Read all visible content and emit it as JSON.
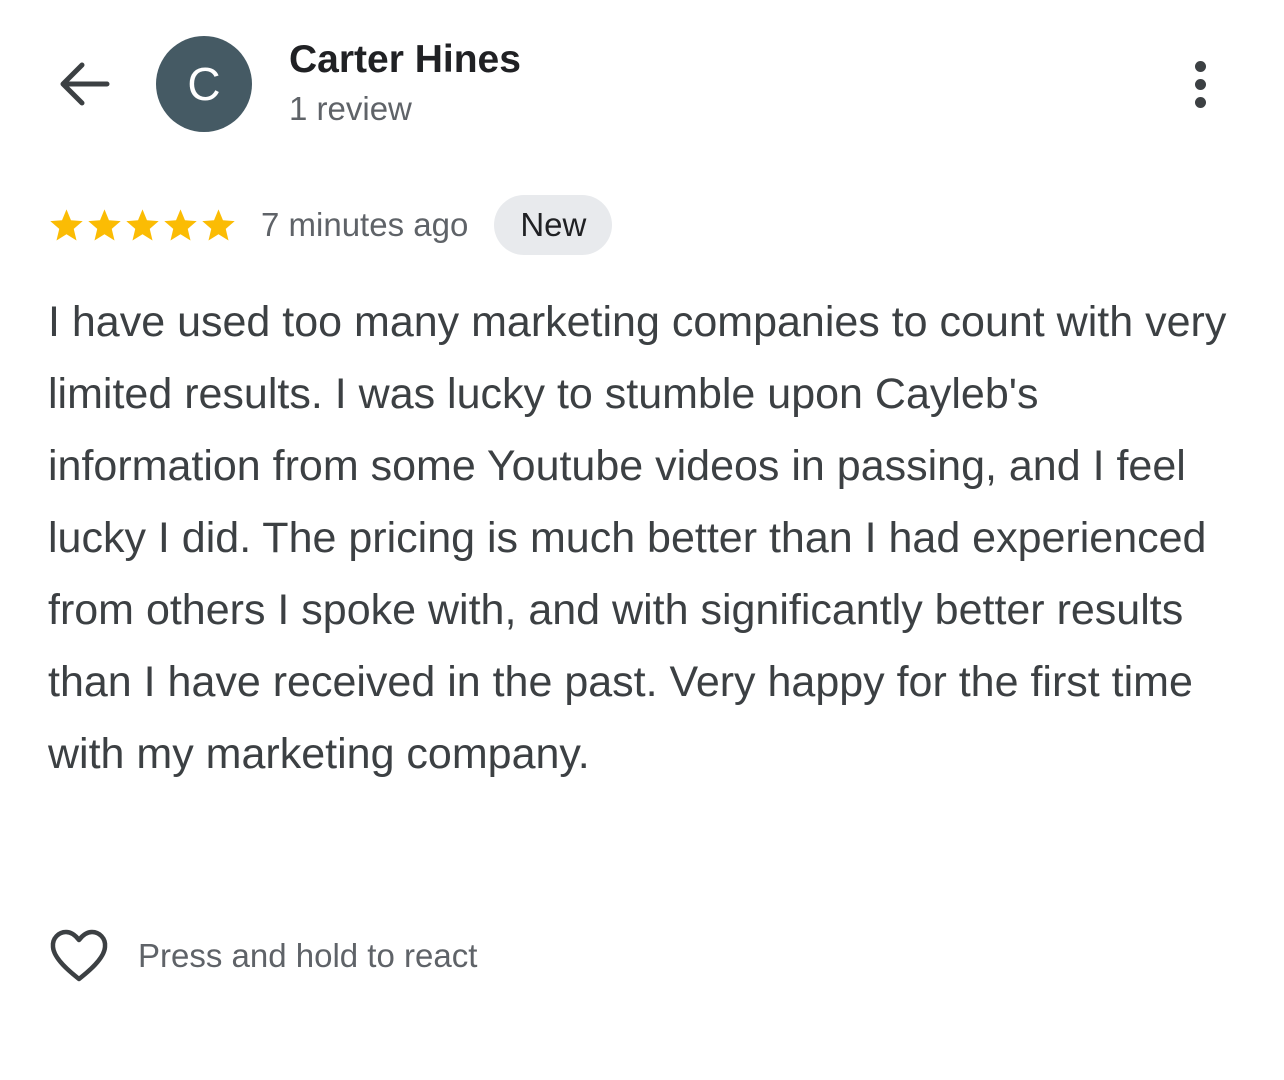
{
  "header": {
    "back_icon": "arrow-back-icon",
    "avatar_letter": "C",
    "avatar_color": "#455a64",
    "author_name": "Carter Hines",
    "review_count": "1 review",
    "more_icon": "more-vert-icon"
  },
  "review": {
    "rating": 5,
    "rating_max": 5,
    "star_color": "#fbbc04",
    "time_ago": "7 minutes ago",
    "badge": "New",
    "text": "I have used too many marketing companies to count with very limited results. I was lucky to stumble upon Cayleb's information from some Youtube videos in passing, and I feel lucky I did. The pricing is much better than I had experienced from others I spoke with, and with significantly better results than I have received in the past. Very happy for the first time with my marketing company."
  },
  "reaction": {
    "heart_icon": "heart-outline-icon",
    "label": "Press and hold to react"
  }
}
